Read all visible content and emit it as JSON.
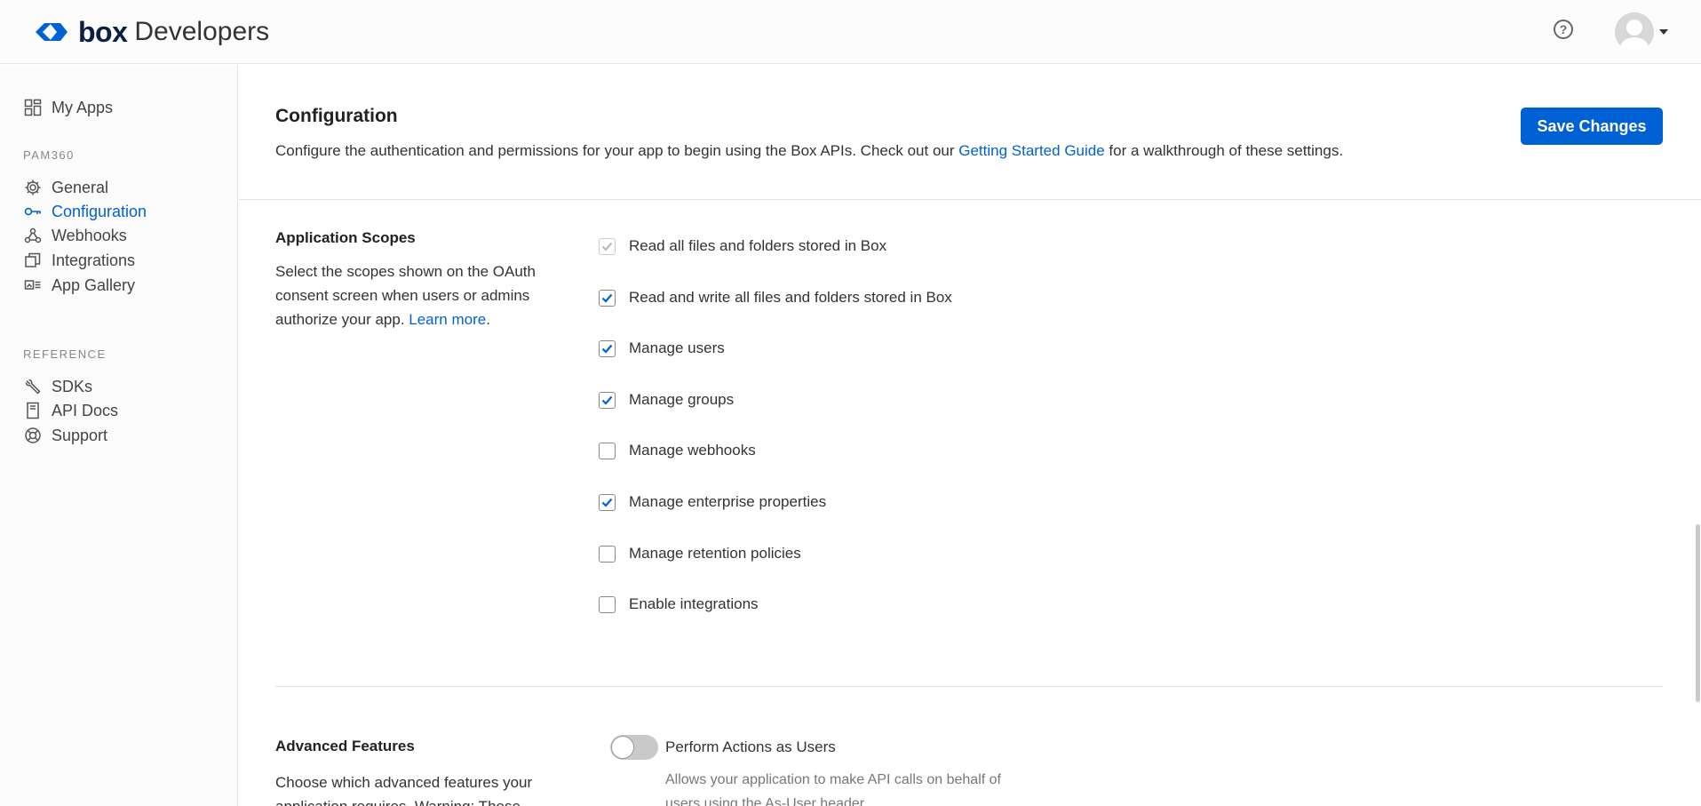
{
  "header": {
    "brand": "box",
    "product": "Developers",
    "help_label": "?"
  },
  "sidebar": {
    "my_apps": "My Apps",
    "app_section": "PAM360",
    "app_items": [
      {
        "label": "General",
        "icon": "gear-icon"
      },
      {
        "label": "Configuration",
        "icon": "key-icon",
        "active": true
      },
      {
        "label": "Webhooks",
        "icon": "webhook-icon"
      },
      {
        "label": "Integrations",
        "icon": "integrations-icon"
      },
      {
        "label": "App Gallery",
        "icon": "gallery-icon"
      }
    ],
    "reference_section": "REFERENCE",
    "reference_items": [
      {
        "label": "SDKs",
        "icon": "wrench-icon"
      },
      {
        "label": "API Docs",
        "icon": "document-icon"
      },
      {
        "label": "Support",
        "icon": "lifebuoy-icon"
      }
    ]
  },
  "main": {
    "title": "Configuration",
    "description_prefix": "Configure the authentication and permissions for your app to begin using the Box APIs. Check out our ",
    "description_link": "Getting Started Guide",
    "description_suffix": " for a walkthrough of these settings.",
    "save_label": "Save Changes",
    "scopes": {
      "title": "Application Scopes",
      "description": "Select the scopes shown on the OAuth consent screen when users or admins authorize your app. ",
      "learn_more": "Learn more",
      "items": [
        {
          "label": "Read all files and folders stored in Box",
          "checked": true,
          "disabled": true
        },
        {
          "label": "Read and write all files and folders stored in Box",
          "checked": true
        },
        {
          "label": "Manage users",
          "checked": true
        },
        {
          "label": "Manage groups",
          "checked": true
        },
        {
          "label": "Manage webhooks",
          "checked": false
        },
        {
          "label": "Manage enterprise properties",
          "checked": true
        },
        {
          "label": "Manage retention policies",
          "checked": false
        },
        {
          "label": "Enable integrations",
          "checked": false
        }
      ]
    },
    "advanced": {
      "title": "Advanced Features",
      "description": "Choose which advanced features your application requires. Warning: These",
      "toggle_label": "Perform Actions as Users",
      "toggle_on": false,
      "toggle_description": "Allows your application to make API calls on behalf of users using the As-User header."
    }
  },
  "colors": {
    "accent": "#0061d5",
    "brand_dark": "#0a1f44"
  }
}
